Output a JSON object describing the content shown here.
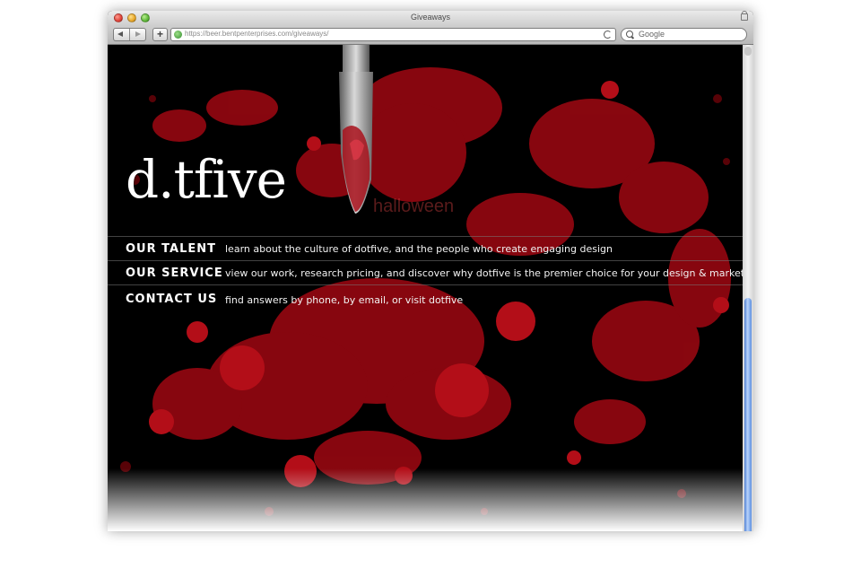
{
  "window": {
    "title": "Giveaways",
    "url": "https://beer.bentpenterprises.com/giveaways/",
    "search_placeholder": "Google"
  },
  "site": {
    "logo": "d.tfive",
    "tagline": "halloween"
  },
  "nav": [
    {
      "label": "OUR TALENT",
      "description": "learn about the culture of dotfive, and the people who create engaging design"
    },
    {
      "label": "OUR SERVICE",
      "description": "view our work, research pricing, and discover why dotfive is the premier choice for your design & marketing"
    },
    {
      "label": "CONTACT US",
      "description": "find answers by phone, by email, or visit dotfive"
    }
  ],
  "colors": {
    "background": "#000000",
    "blood": "#9b0a12",
    "text": "#ffffff",
    "scroll_thumb": "#5b8fe0"
  },
  "icons": [
    "close-icon",
    "minimize-icon",
    "zoom-icon",
    "lock-icon",
    "back-icon",
    "forward-icon",
    "add-icon",
    "globe-icon",
    "reload-icon",
    "search-icon"
  ]
}
